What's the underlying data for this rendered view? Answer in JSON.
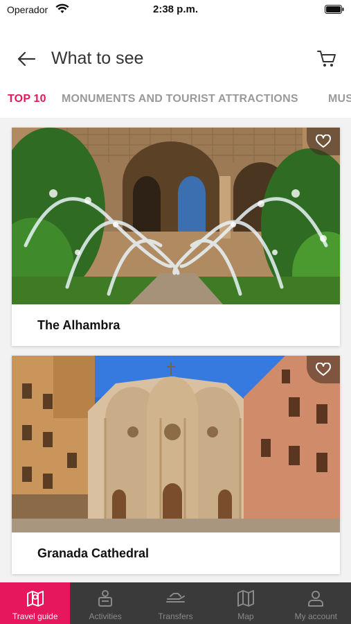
{
  "status_bar": {
    "carrier": "Operador",
    "time": "2:38 p.m."
  },
  "header": {
    "title": "What to see"
  },
  "tabs": [
    {
      "label": "TOP 10",
      "active": true
    },
    {
      "label": "MONUMENTS AND TOURIST ATTRACTIONS",
      "active": false
    },
    {
      "label": "MUS",
      "active": false
    }
  ],
  "cards": [
    {
      "title": "The Alhambra"
    },
    {
      "title": "Granada Cathedral"
    }
  ],
  "bottom_nav": [
    {
      "label": "Travel guide",
      "icon": "map-icon",
      "active": true
    },
    {
      "label": "Activities",
      "icon": "activities-icon",
      "active": false
    },
    {
      "label": "Transfers",
      "icon": "transfers-icon",
      "active": false
    },
    {
      "label": "Map",
      "icon": "map-folded-icon",
      "active": false
    },
    {
      "label": "My account",
      "icon": "user-icon",
      "active": false
    }
  ],
  "colors": {
    "accent": "#e6175c",
    "tabbar": "#3a3a3a"
  }
}
